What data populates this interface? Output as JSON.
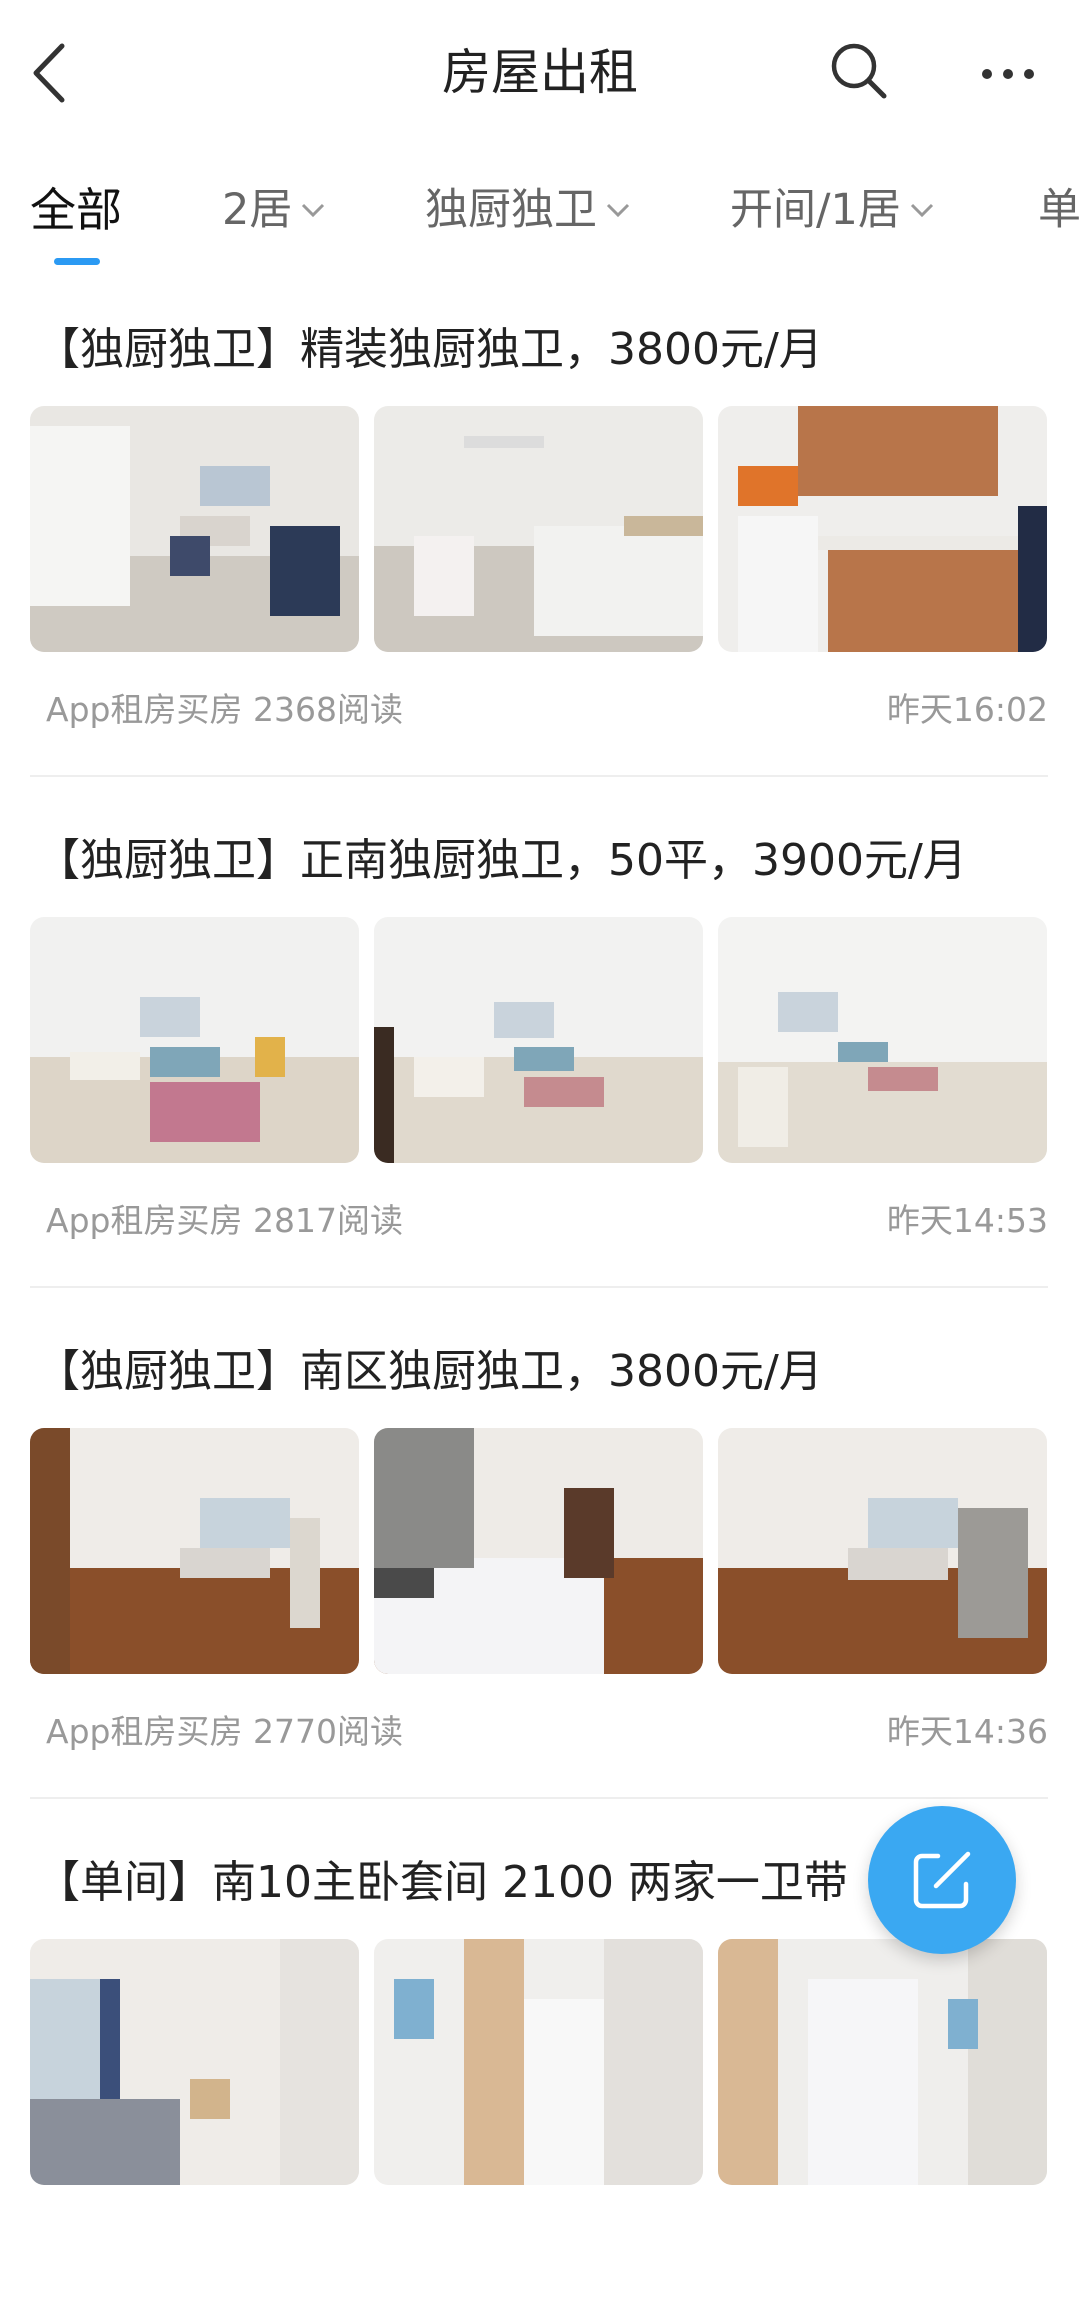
{
  "header": {
    "title": "房屋出租"
  },
  "tabs": [
    {
      "label": "全部"
    },
    {
      "label": "2居"
    },
    {
      "label": "独厨独卫"
    },
    {
      "label": "开间/1居"
    },
    {
      "label": "单"
    }
  ],
  "listings": [
    {
      "title": "【独厨独卫】精装独厨独卫，3800元/月",
      "source": "App租房买房 2368阅读",
      "time": "昨天16:02"
    },
    {
      "title": "【独厨独卫】正南独厨独卫，50平，3900元/月",
      "source": "App租房买房 2817阅读",
      "time": "昨天14:53"
    },
    {
      "title": "【独厨独卫】南区独厨独卫，3800元/月",
      "source": "App租房买房 2770阅读",
      "time": "昨天14:36"
    },
    {
      "title": "【单间】南10主卧套间 2100 两家一卫带",
      "source": "",
      "time": ""
    }
  ],
  "colors": {
    "accent": "#2b9af3",
    "fab": "#3aa8f2"
  },
  "icons": [
    "back-arrow-icon",
    "search-icon",
    "more-dots-icon",
    "chevron-down-icon",
    "compose-icon"
  ]
}
